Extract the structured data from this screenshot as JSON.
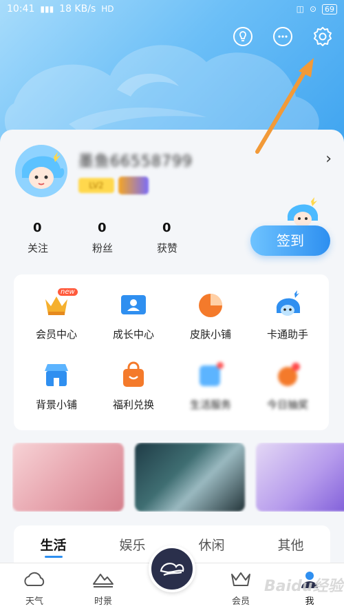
{
  "status_bar": {
    "time": "10:41",
    "speed": "18 KB/s",
    "battery": "69"
  },
  "profile": {
    "username": "墨鱼66558799",
    "level_badge": "LV2"
  },
  "stats": [
    {
      "value": "0",
      "label": "关注"
    },
    {
      "value": "0",
      "label": "粉丝"
    },
    {
      "value": "0",
      "label": "获赞"
    }
  ],
  "checkin_label": "签到",
  "services": [
    {
      "label": "会员中心",
      "tag": "new"
    },
    {
      "label": "成长中心"
    },
    {
      "label": "皮肤小铺"
    },
    {
      "label": "卡通助手"
    },
    {
      "label": "背景小铺"
    },
    {
      "label": "福利兑换"
    },
    {
      "label": "生活服务"
    },
    {
      "label": "今日抽奖"
    }
  ],
  "tabs": [
    "生活",
    "娱乐",
    "休闲",
    "其他"
  ],
  "bottom_nav": [
    {
      "label": "天气"
    },
    {
      "label": "时景"
    },
    {
      "label": "会员"
    },
    {
      "label": "我"
    }
  ],
  "watermark": "Baidu经验",
  "colors": {
    "accent": "#2d8ff0",
    "sky": "#6cbff7",
    "arrow": "#f29a38"
  }
}
